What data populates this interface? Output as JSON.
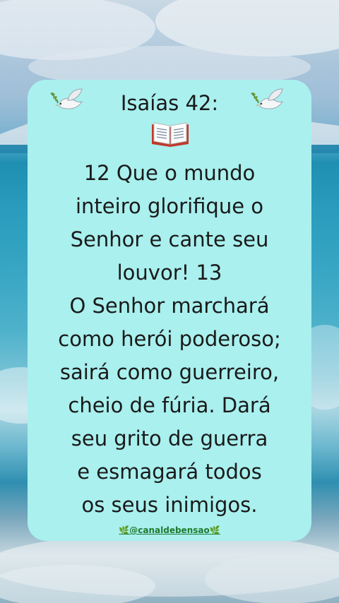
{
  "post": {
    "title": "Isaías 42:",
    "verse_lines": [
      "12 Que o mundo",
      "inteiro glorifique o",
      "Senhor e cante seu",
      "louvor! 13",
      "O Senhor marchará",
      "como herói poderoso;",
      "sairá como guerreiro,",
      "cheio de fúria. Dará",
      "seu grito de guerra",
      "e esmagará todos",
      "os seus inimigos."
    ],
    "handle": "@canaldebensao"
  },
  "icons": {
    "left": "dove-with-olive-branch-icon",
    "center": "open-book-icon",
    "right": "dove-with-olive-branch-icon",
    "handle_decor": "herb-icon"
  },
  "colors": {
    "card": "#a9f0ee",
    "text": "#1a1a1a",
    "handle": "#1f7a2e"
  }
}
